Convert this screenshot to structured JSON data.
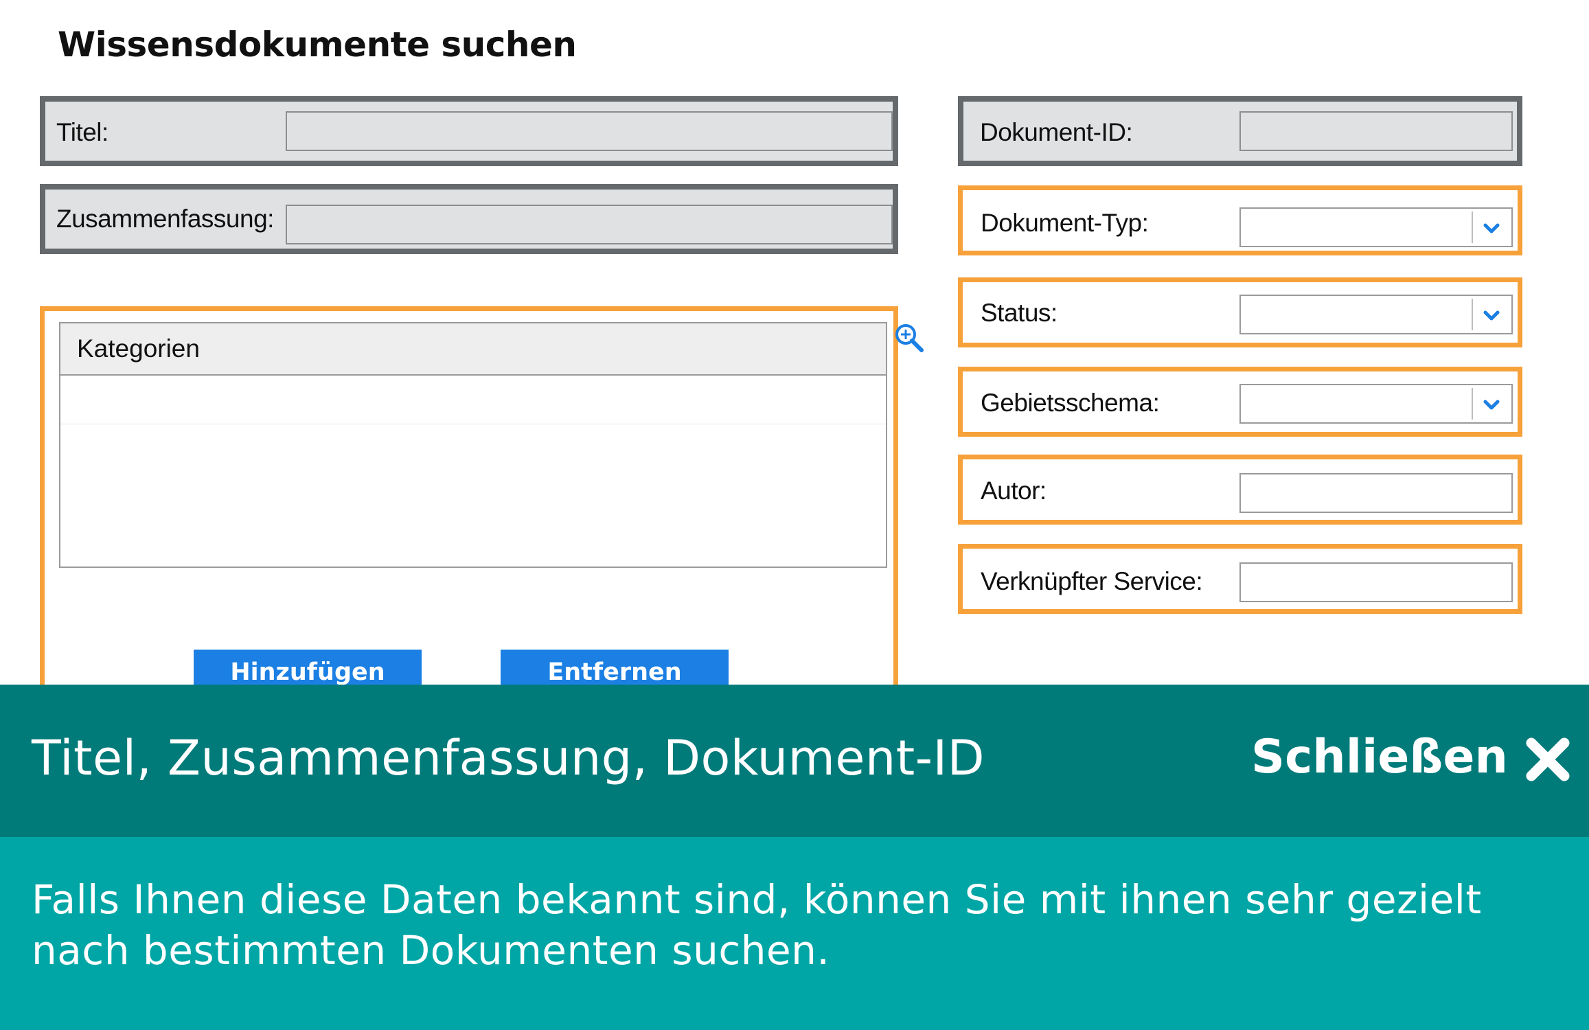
{
  "page": {
    "title": "Wissensdokumente suchen"
  },
  "left_fields": {
    "titel": {
      "label": "Titel:",
      "value": ""
    },
    "zusammenfassung": {
      "label": "Zusammenfassung:",
      "value": ""
    }
  },
  "categories": {
    "header": "Kategorien",
    "add_label": "Hinzufügen",
    "remove_label": "Entfernen",
    "zoom_icon": "zoom-in-icon"
  },
  "right_fields": {
    "dokument_id": {
      "label": "Dokument-ID:",
      "value": ""
    },
    "dokument_typ": {
      "label": "Dokument-Typ:",
      "value": ""
    },
    "status": {
      "label": "Status:",
      "value": ""
    },
    "gebietsschema": {
      "label": "Gebietsschema:",
      "value": ""
    },
    "autor": {
      "label": "Autor:",
      "value": ""
    },
    "verknuepfter_service": {
      "label": "Verknüpfter Service:",
      "value": ""
    }
  },
  "overlay": {
    "title": "Titel, Zusammenfassung, Dokument-ID",
    "close_label": "Schließen",
    "close_icon": "close-icon",
    "description": "Falls Ihnen diese Daten bekannt sind, können Sie mit ihnen sehr gezielt nach bestimmten Dokumenten suchen."
  },
  "colors": {
    "highlight_orange": "#f7a13a",
    "frame_grey": "#66696b",
    "button_blue": "#1b7fe3",
    "banner_dark": "#017b7a",
    "banner_light": "#00a6a5"
  }
}
